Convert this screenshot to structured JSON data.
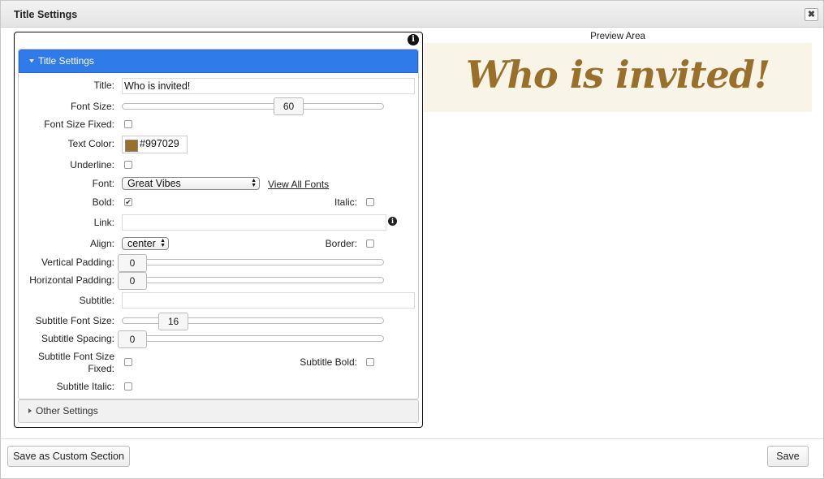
{
  "dialog": {
    "title": "Title Settings",
    "close_icon": "close-x-icon"
  },
  "section": {
    "header": "Title Settings",
    "other_header": "Other Settings"
  },
  "fields": {
    "title_label": "Title:",
    "title_value": "Who is invited!",
    "font_size_label": "Font Size:",
    "font_size_value": "60",
    "font_size_fixed_label": "Font Size Fixed:",
    "text_color_label": "Text Color:",
    "text_color_value": "#997029",
    "underline_label": "Underline:",
    "font_label": "Font:",
    "font_value": "Great Vibes",
    "view_all_fonts": "View All Fonts",
    "bold_label": "Bold:",
    "bold_checked": true,
    "italic_label": "Italic:",
    "link_label": "Link:",
    "link_value": "",
    "align_label": "Align:",
    "align_value": "center",
    "border_label": "Border:",
    "vertical_padding_label": "Vertical Padding:",
    "vertical_padding_value": "0",
    "horizontal_padding_label": "Horizontal Padding:",
    "horizontal_padding_value": "0",
    "subtitle_label": "Subtitle:",
    "subtitle_value": "",
    "subtitle_font_size_label": "Subtitle Font Size:",
    "subtitle_font_size_value": "16",
    "subtitle_spacing_label": "Subtitle Spacing:",
    "subtitle_spacing_value": "0",
    "subtitle_font_size_fixed_label_1": "Subtitle Font Size",
    "subtitle_font_size_fixed_label_2": "Fixed:",
    "subtitle_bold_label": "Subtitle Bold:",
    "subtitle_italic_label": "Subtitle Italic:"
  },
  "preview": {
    "label": "Preview Area",
    "title": "Who is invited!"
  },
  "footer": {
    "save_custom": "Save as Custom Section",
    "save": "Save"
  },
  "colors": {
    "accent": "#2f7bea",
    "text_color": "#997029",
    "preview_bg": "#f8f5e8"
  }
}
